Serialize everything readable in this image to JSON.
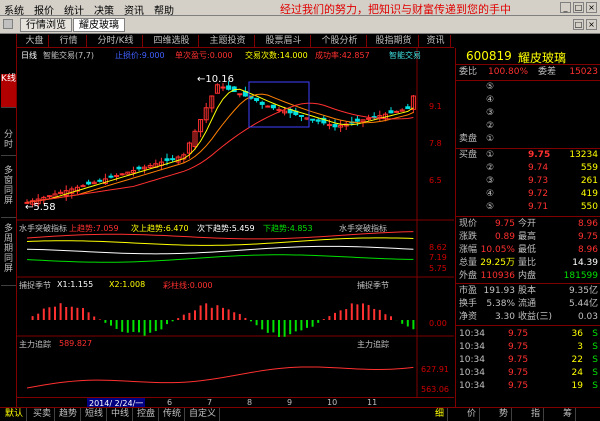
{
  "menu": {
    "items": [
      "系统",
      "报价",
      "统计",
      "决策",
      "资讯",
      "帮助"
    ],
    "slogan": "经过我们的努力，把知识与财富传递到您的手中"
  },
  "window_tabs": [
    "行情浏览",
    "耀皮玻璃"
  ],
  "left_tabs": [
    "K线",
    "分时",
    "多窗同屏",
    "多周期同屏"
  ],
  "func_tabs": [
    "大盘",
    "行情",
    "分时/K线",
    "四维选股",
    "主题投资",
    "股票眉斗",
    "个股分析",
    "股指期货",
    "资讯"
  ],
  "stock": {
    "code": "600819",
    "name": "耀皮玻璃"
  },
  "main_chart": {
    "period": "日线",
    "indicator": "智能交易(7,7)",
    "legend": [
      {
        "text": "止损价:9.000",
        "color": "#4060ff"
      },
      {
        "text": "单次盈亏:0.000",
        "color": "#ff3030"
      },
      {
        "text": "交易次数:14.000",
        "color": "#ffff00"
      },
      {
        "text": "成功率:42.857",
        "color": "#ff3030"
      },
      {
        "text": "智能交易",
        "color": "#40e0e0"
      }
    ],
    "high_label": "10.16",
    "low_label": "5.58",
    "yaxis": [
      "9.1",
      "7.8",
      "6.5"
    ]
  },
  "panel2": {
    "title": "水手突破指标",
    "legend": [
      {
        "text": "上趋势:7.059",
        "color": "#ff3030"
      },
      {
        "text": "次上趋势:6.470",
        "color": "#ffff00"
      },
      {
        "text": "次下趋势:5.459",
        "color": "#ffffff"
      },
      {
        "text": "下趋势:4.853",
        "color": "#00e000"
      }
    ],
    "title_right": "水手突破指标",
    "yaxis": [
      "8.62",
      "7.19",
      "5.75"
    ]
  },
  "panel3": {
    "title": "捕捉季节",
    "legend": [
      {
        "text": "X1:1.155",
        "color": "#ffffff"
      },
      {
        "text": "X2:1.008",
        "color": "#ffff00"
      },
      {
        "text": "彩柱线:0.000",
        "color": "#ff3030"
      }
    ],
    "title_right": "捕捉季节",
    "yaxis": [
      "0.00"
    ]
  },
  "panel4": {
    "title": "主力追踪",
    "legend": [
      {
        "text": "589.827",
        "color": "#ff3030"
      }
    ],
    "title_right": "主力追踪",
    "yaxis": [
      "627.91",
      "563.06"
    ]
  },
  "date_bar": {
    "date": "2014/ 2/24/一",
    "months": [
      "6",
      "7",
      "8",
      "9",
      "10",
      "11"
    ]
  },
  "quote": {
    "weibi": {
      "label": "委比",
      "pct": "100.80%",
      "label2": "委差",
      "val": "15023"
    },
    "sells": [
      "⑤",
      "④",
      "③",
      "②",
      "①"
    ],
    "sell_label": "卖盘",
    "buys": [
      {
        "label": "买盘",
        "idx": "①",
        "price": "9.75",
        "vol": "13234"
      },
      {
        "label": "",
        "idx": "②",
        "price": "9.74",
        "vol": "559"
      },
      {
        "label": "",
        "idx": "③",
        "price": "9.73",
        "vol": "261"
      },
      {
        "label": "",
        "idx": "④",
        "price": "9.72",
        "vol": "419"
      },
      {
        "label": "",
        "idx": "⑤",
        "price": "9.71",
        "vol": "550"
      }
    ],
    "stats": [
      {
        "l1": "现价",
        "v1": "9.75",
        "l2": "今开",
        "v2": "8.96",
        "c1": "red",
        "c2": "red"
      },
      {
        "l1": "涨跌",
        "v1": "0.89",
        "l2": "最高",
        "v2": "9.75",
        "c1": "red",
        "c2": "red"
      },
      {
        "l1": "涨幅",
        "v1": "10.05%",
        "l2": "最低",
        "v2": "8.96",
        "c1": "red",
        "c2": "red"
      },
      {
        "l1": "总量",
        "v1": "29.25万",
        "l2": "量比",
        "v2": "14.39",
        "c1": "yellow",
        "c2": "white"
      },
      {
        "l1": "外盘",
        "v1": "110936",
        "l2": "内盘",
        "v2": "181599",
        "c1": "red",
        "c2": "green"
      }
    ],
    "stats2": [
      {
        "l1": "市盈",
        "v1": "191.93",
        "l2": "股本",
        "v2": "9.35亿"
      },
      {
        "l1": "换手",
        "v1": "5.38%",
        "l2": "流通",
        "v2": "5.44亿"
      },
      {
        "l1": "净资",
        "v1": "3.30",
        "l2": "收益(三)",
        "v2": "0.03"
      }
    ],
    "ticks": [
      {
        "t": "10:34",
        "p": "9.75",
        "v": "36",
        "f": "S"
      },
      {
        "t": "10:34",
        "p": "9.75",
        "v": "3",
        "f": "S"
      },
      {
        "t": "10:34",
        "p": "9.75",
        "v": "22",
        "f": "S"
      },
      {
        "t": "10:34",
        "p": "9.75",
        "v": "24",
        "f": "S"
      },
      {
        "t": "10:34",
        "p": "9.75",
        "v": "19",
        "f": "S"
      }
    ]
  },
  "bottom_tabs": [
    "默认",
    "买卖",
    "趋势",
    "短线",
    "中线",
    "控盘",
    "传统",
    "自定义"
  ],
  "bottom_right_tabs": [
    "细",
    "价",
    "势",
    "指",
    "筹"
  ],
  "colors": {
    "up": "#ff3030",
    "down": "#00e000",
    "ma1": "#ffff00",
    "ma2": "#ff6000",
    "accent": "#b00000"
  }
}
